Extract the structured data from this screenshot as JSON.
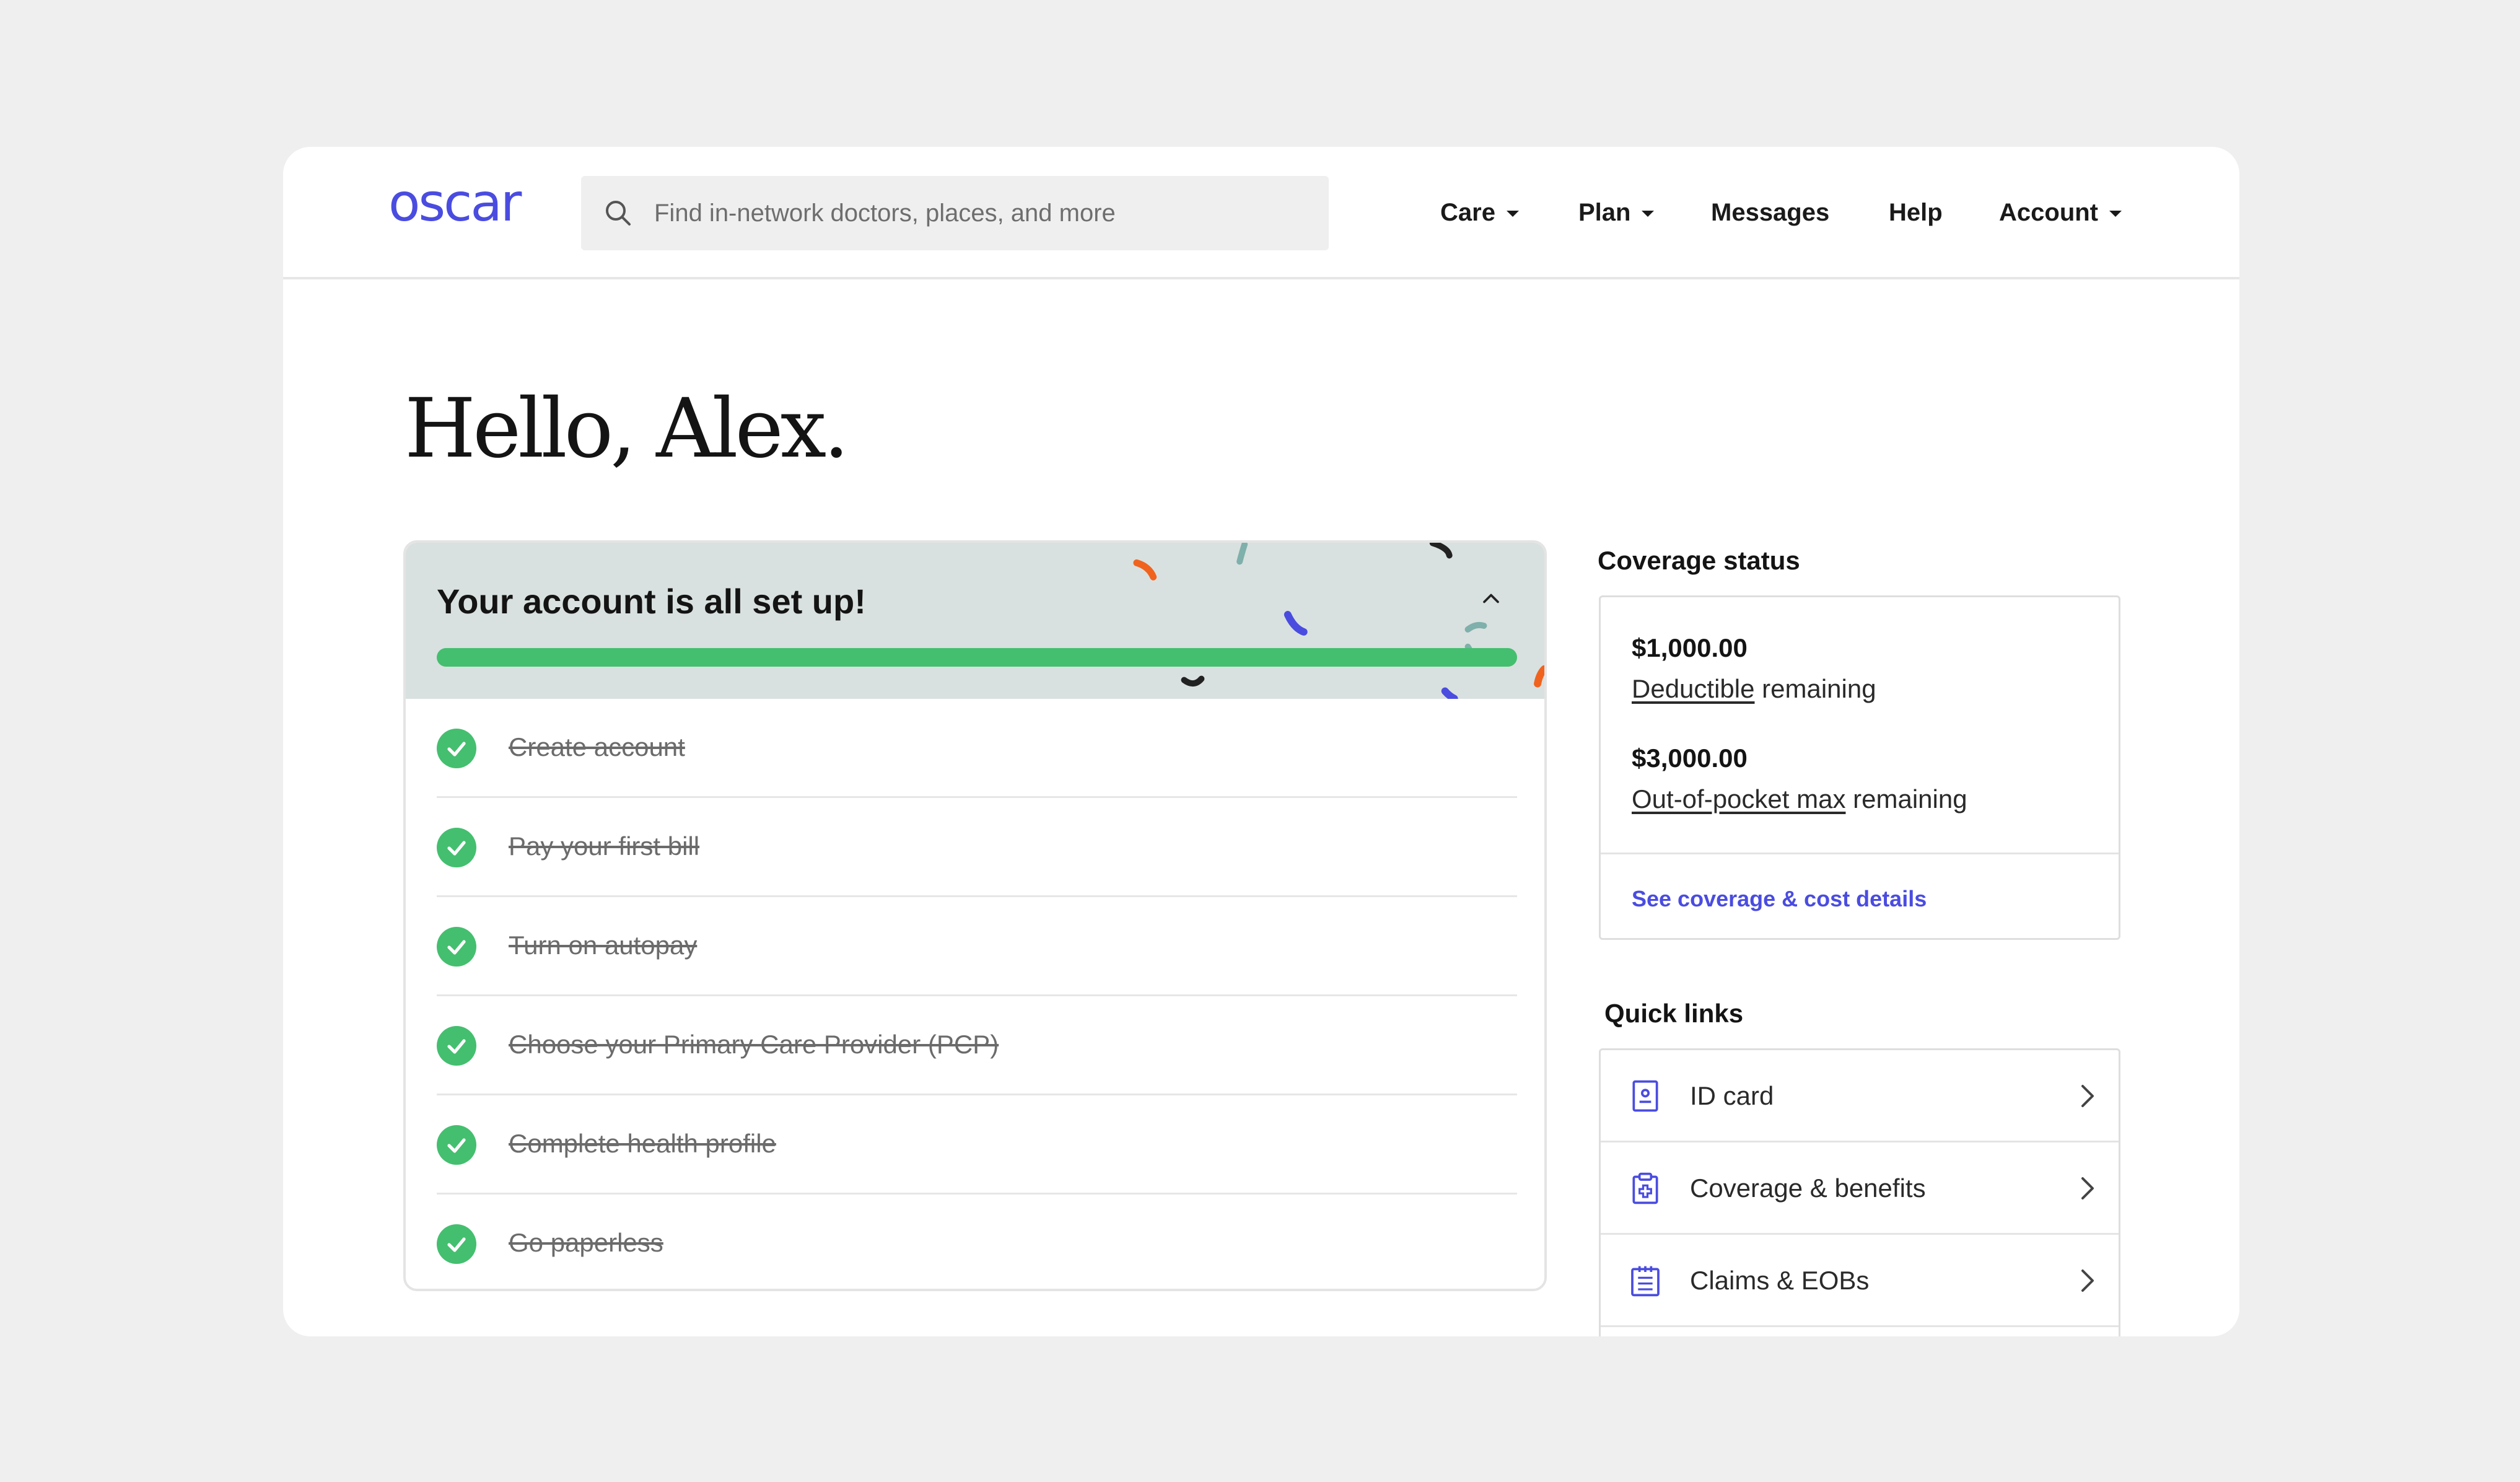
{
  "header": {
    "logo": "oscar",
    "search_placeholder": "Find in-network doctors, places, and more",
    "nav": [
      {
        "label": "Care",
        "dropdown": true
      },
      {
        "label": "Plan",
        "dropdown": true
      },
      {
        "label": "Messages",
        "dropdown": false
      },
      {
        "label": "Help",
        "dropdown": false
      },
      {
        "label": "Account",
        "dropdown": true
      }
    ]
  },
  "greeting": "Hello, Alex.",
  "setup": {
    "title": "Your account is all set up!",
    "progress": 1.0,
    "tasks": [
      {
        "label": "Create account",
        "done": true
      },
      {
        "label": "Pay your first bill",
        "done": true
      },
      {
        "label": "Turn on autopay",
        "done": true
      },
      {
        "label": "Choose your Primary Care Provider (PCP)",
        "done": true
      },
      {
        "label": "Complete health profile",
        "done": true
      },
      {
        "label": "Go paperless",
        "done": true
      }
    ]
  },
  "coverage": {
    "title": "Coverage status",
    "deductible_amount": "$1,000.00",
    "deductible_term": "Deductible",
    "deductible_suffix": " remaining",
    "oop_amount": "$3,000.00",
    "oop_term": "Out-of-pocket max",
    "oop_suffix": " remaining",
    "link": "See coverage & cost details"
  },
  "quick_links": {
    "title": "Quick links",
    "items": [
      {
        "label": "ID card",
        "icon": "id-card-icon"
      },
      {
        "label": "Coverage & benefits",
        "icon": "clipboard-plus-icon"
      },
      {
        "label": "Claims & EOBs",
        "icon": "calendar-list-icon"
      }
    ]
  },
  "colors": {
    "brand": "#4a4ce0",
    "success": "#44bf6f",
    "setup_header_bg": "#d8e1df",
    "page_bg": "#efefef"
  }
}
